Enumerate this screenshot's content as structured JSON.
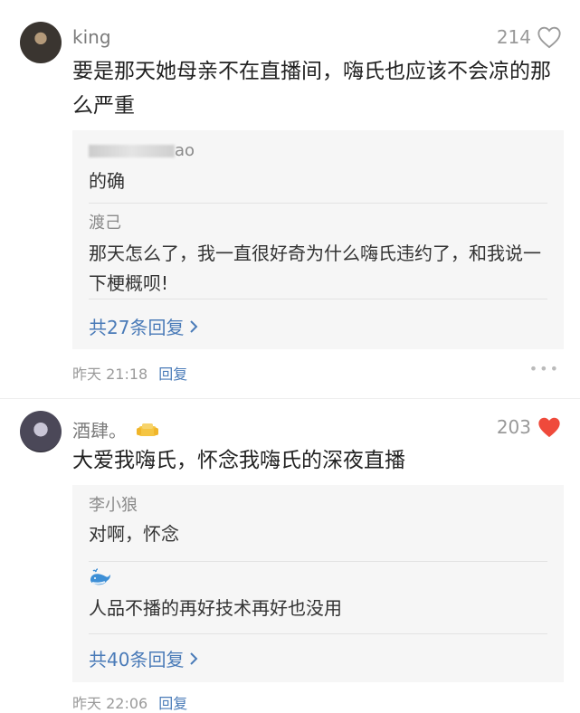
{
  "comments": [
    {
      "username": "king",
      "likes": "214",
      "liked": false,
      "text": "要是那天她母亲不在直播间，嗨氏也应该不会凉的那么严重",
      "replies": [
        {
          "name": "ao",
          "text": "的确"
        },
        {
          "name": "渡己",
          "text": "那天怎么了，我一直很好奇为什么嗨氏违约了，和我说一下梗概呗!"
        }
      ],
      "more_replies": "共27条回复",
      "time": "昨天 21:18",
      "reply_label": "回复",
      "more_icon": "more-dots-icon"
    },
    {
      "username": "酒肆。",
      "badge_icon": "vip-badge-icon",
      "likes": "203",
      "liked": true,
      "text": "大爱我嗨氏，怀念我嗨氏的深夜直播",
      "replies": [
        {
          "name": "李小狼",
          "text": "对啊，怀念"
        },
        {
          "name_icon": "whale-icon",
          "text": "人品不播的再好技术再好也没用"
        }
      ],
      "more_replies": "共40条回复",
      "time": "昨天 22:06",
      "reply_label": "回复"
    }
  ],
  "colors": {
    "link": "#4a7bb8",
    "heart_liked": "#ef4a3b",
    "reply_bg": "#f6f6f6"
  }
}
